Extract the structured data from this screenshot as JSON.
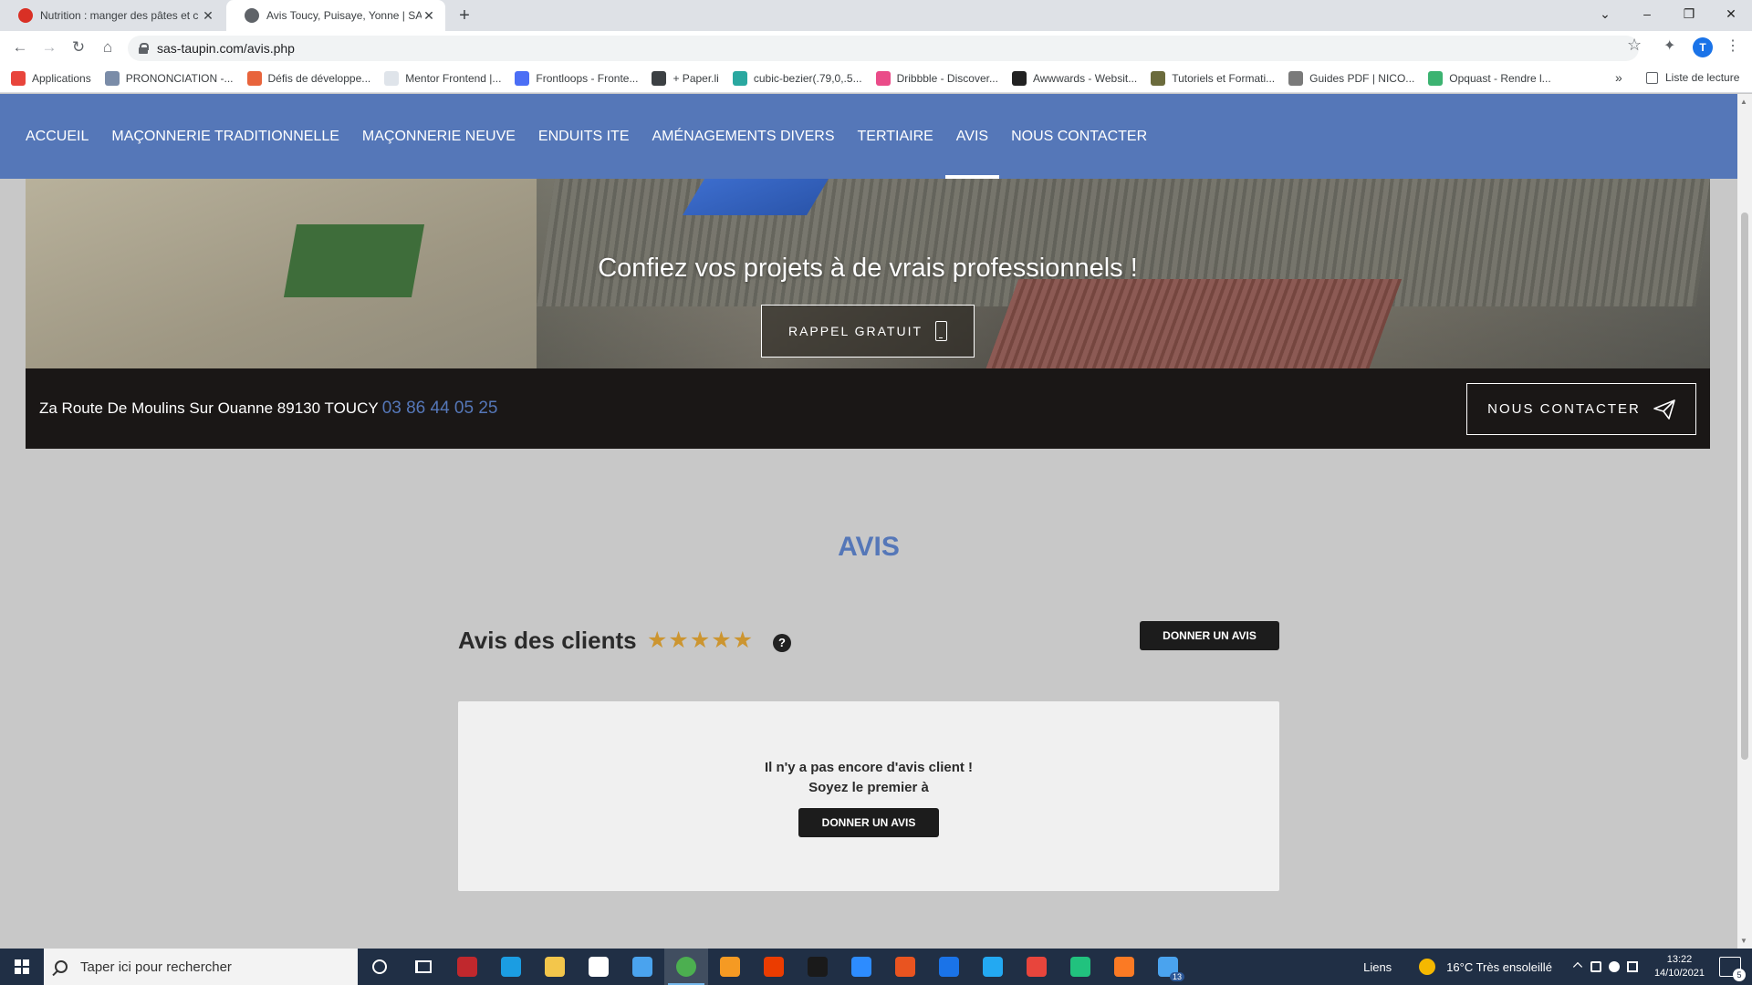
{
  "browser": {
    "tabs": [
      {
        "title": "Nutrition : manger des pâtes et c",
        "favicon_color": "#d93025",
        "favicon_glyph": "●"
      },
      {
        "title": "Avis Toucy, Puisaye, Yonne | SAS",
        "favicon_color": "#5f6368",
        "favicon_glyph": "◍"
      }
    ],
    "new_tab_glyph": "+",
    "url": "sas-taupin.com/avis.php",
    "profile_initial": "T",
    "bookmarks": [
      {
        "label": "Applications",
        "color": "#e8453c"
      },
      {
        "label": "PRONONCIATION -...",
        "color": "#7a8ca8"
      },
      {
        "label": "Défis de développe...",
        "color": "#e8643c"
      },
      {
        "label": "Mentor Frontend |...",
        "color": "#dfe4ea"
      },
      {
        "label": "Frontloops - Fronte...",
        "color": "#4b6ef5"
      },
      {
        "label": "+ Paper.li",
        "color": "#3c4043"
      },
      {
        "label": "cubic-bezier(.79,0,.5...",
        "color": "#2aa8a0"
      },
      {
        "label": "Dribbble - Discover...",
        "color": "#ea4c89"
      },
      {
        "label": "Awwwards - Websit...",
        "color": "#222222"
      },
      {
        "label": "Tutoriels et Formati...",
        "color": "#6b6b3c"
      },
      {
        "label": "Guides PDF | NICO...",
        "color": "#7a7a7a"
      },
      {
        "label": "Opquast - Rendre l...",
        "color": "#3cb371"
      }
    ],
    "bookmarks_more": "»",
    "reading_list": "Liste de lecture"
  },
  "site": {
    "nav": [
      {
        "label": "ACCUEIL",
        "active": false
      },
      {
        "label": "MAÇONNERIE TRADITIONNELLE",
        "active": false
      },
      {
        "label": "MAÇONNERIE NEUVE",
        "active": false
      },
      {
        "label": "ENDUITS ITE",
        "active": false
      },
      {
        "label": "AMÉNAGEMENTS DIVERS",
        "active": false
      },
      {
        "label": "TERTIAIRE",
        "active": false
      },
      {
        "label": "AVIS",
        "active": true
      },
      {
        "label": "NOUS CONTACTER",
        "active": false
      }
    ],
    "hero": {
      "headline": "Confiez vos projets à de vrais professionnels !",
      "callback_label": "RAPPEL GRATUIT"
    },
    "infobar": {
      "address": "Za Route De Moulins Sur Ouanne 89130 TOUCY",
      "phone": "03 86 44 05 25",
      "contact_label": "NOUS CONTACTER"
    },
    "section_title": "AVIS",
    "reviews": {
      "heading": "Avis des clients",
      "stars": "★★★★★",
      "rating_stars": 5,
      "help_glyph": "?",
      "give_review_label": "DONNER UN AVIS",
      "empty_line1": "Il n'y a pas encore d'avis client !",
      "empty_line2": "Soyez le premier à",
      "empty_give_label": "DONNER UN AVIS"
    },
    "colors": {
      "accent": "#5577b8",
      "star": "#cc9530",
      "dark": "#1a1716"
    }
  },
  "taskbar": {
    "search_placeholder": "Taper ici pour rechercher",
    "apps": [
      {
        "name": "redis-app-icon",
        "color": "#c0282d"
      },
      {
        "name": "edge-icon",
        "color": "#1b9de2"
      },
      {
        "name": "file-explorer-icon",
        "color": "#f3c64b"
      },
      {
        "name": "store-icon",
        "color": "#ffffff"
      },
      {
        "name": "mail-icon",
        "color": "#4aa3ee"
      },
      {
        "name": "chrome-icon",
        "color": "#4caf50",
        "active": true
      },
      {
        "name": "sublime-icon",
        "color": "#f59a23"
      },
      {
        "name": "office-icon",
        "color": "#eb3c00"
      },
      {
        "name": "terminal-app-icon",
        "color": "#1a1a1a"
      },
      {
        "name": "zoom-icon",
        "color": "#2d8cff"
      },
      {
        "name": "ubuntu-icon",
        "color": "#e95420"
      },
      {
        "name": "maps-icon",
        "color": "#1a73e8"
      },
      {
        "name": "vscode-icon",
        "color": "#23a9f2"
      },
      {
        "name": "git-icon",
        "color": "#e8453c"
      },
      {
        "name": "dev-app-icon",
        "color": "#21c27e"
      },
      {
        "name": "xampp-icon",
        "color": "#fb7a24"
      },
      {
        "name": "multi-window-icon",
        "color": "#4aa3ee"
      }
    ],
    "badge_count": "13",
    "links_label": "Liens",
    "weather": "16°C  Très ensoleillé",
    "time": "13:22",
    "date": "14/10/2021",
    "notification_count": "5"
  }
}
